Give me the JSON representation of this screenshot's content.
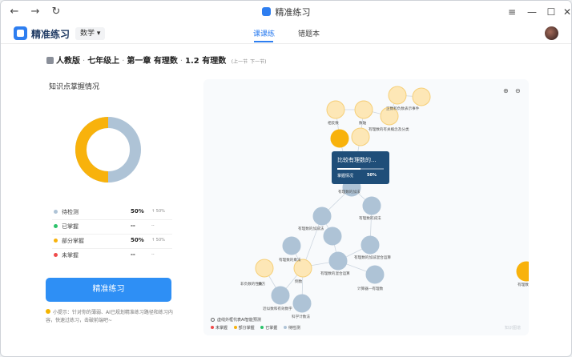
{
  "window": {
    "title": "精准练习",
    "nav": {
      "back": "←",
      "forward": "→",
      "refresh": "↻"
    },
    "controls": {
      "menu": "≡",
      "minimize": "—",
      "maximize": "☐",
      "close": "✕"
    }
  },
  "app": {
    "logo_text": "精准练习",
    "subject": "数学",
    "subject_arrow": "▾",
    "tabs": [
      {
        "label": "课课练",
        "active": true
      },
      {
        "label": "错题本",
        "active": false
      }
    ]
  },
  "breadcrumb": {
    "items": [
      "人教版",
      "七年级上",
      "第一章 有理数",
      "1.2 有理数"
    ],
    "prev": "上一节",
    "next": "下一节"
  },
  "mastery": {
    "title": "知识点掌握情况",
    "donut": {
      "to_test": 50,
      "partial": 50
    },
    "rows": [
      {
        "label": "待检测",
        "color": "#aec3d6",
        "pct": "50%",
        "trend": "↑ 50%"
      },
      {
        "label": "已掌握",
        "color": "#2cc36b",
        "pct": "--",
        "trend": "--"
      },
      {
        "label": "部分掌握",
        "color": "#f8b20c",
        "pct": "50%",
        "trend": "↑ 50%"
      },
      {
        "label": "未掌握",
        "color": "#ef4b4b",
        "pct": "--",
        "trend": "--"
      }
    ],
    "practice_button": "精准练习",
    "tip": "小提示：针对你的薄弱、AI已规划精准练习路径和练习内容，快速过练习，击破前端吧~"
  },
  "graph": {
    "zoom_in": "⊕",
    "zoom_out": "⊖",
    "tooltip": {
      "title": "比较有理数的...",
      "row": "掌握情况",
      "pct": "50%"
    },
    "node_labels": {
      "a": "相反数",
      "b": "数轴",
      "c": "有理数的有关概念及分类",
      "d": "正数和负数表示事件",
      "e": "有理数的加法",
      "f": "有理数的减法",
      "g": "有理数的加减法",
      "h": "有理数的加减混合运算",
      "i": "有理数的乘法",
      "j": "倒数",
      "k": "有理数的混合运算",
      "l": "乘方",
      "m": "非负数的性质",
      "n": "近似数和有效数字",
      "o": "科学计数法",
      "p": "计算器—有理数",
      "q": "有理数"
    },
    "legend": {
      "note": "虚线外框代表AI智能预测",
      "items": [
        {
          "label": "未掌握",
          "color": "#ef4b4b"
        },
        {
          "label": "部分掌握",
          "color": "#f8b20c"
        },
        {
          "label": "已掌握",
          "color": "#2cc36b"
        },
        {
          "label": "待检测",
          "color": "#aec3d6"
        }
      ]
    },
    "watermark": "知识图谱"
  }
}
